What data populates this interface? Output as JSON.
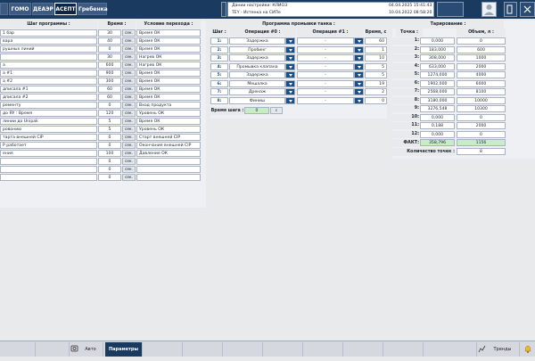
{
  "tabs": [
    "ГОМО",
    "ДЕАЭР",
    "АСЕПТ",
    "Гребенка"
  ],
  "active_tab": 2,
  "info": {
    "line1": "Дании настройки: КЛИО3",
    "line2": "TEY - Истенка на СИПе",
    "date1": "04.04.2025 15:41:43",
    "date2": "10.04.2022 08:58:20"
  },
  "program": {
    "title": "Шаг программы :",
    "time_title": "Время :",
    "cond_title": "Условие перехода :",
    "sec_label": "сек.",
    "rows": [
      {
        "name": "1 бар",
        "time": "30",
        "cond": "Время ОК"
      },
      {
        "name": "вара",
        "time": "40",
        "cond": "Время ОК"
      },
      {
        "name": "рушных линий",
        "time": "0",
        "cond": "Время ОК"
      },
      {
        "name": "",
        "time": "30",
        "cond": "Нагрев ОК"
      },
      {
        "name": "а",
        "time": "600",
        "cond": "Нагрев ОК"
      },
      {
        "name": "а #1",
        "time": "900",
        "cond": "Время ОК"
      },
      {
        "name": "а #2",
        "time": "300",
        "cond": "Время ОК"
      },
      {
        "name": "дписала #1",
        "time": "60",
        "cond": "Время ОК"
      },
      {
        "name": "дписала #2",
        "time": "60",
        "cond": "Время ОК"
      },
      {
        "name": "ременту",
        "time": "0",
        "cond": "Вход продукта"
      },
      {
        "name": "до ЯУ : Время",
        "time": "120",
        "cond": "Уровень ОК"
      },
      {
        "name": "линии до Unipak",
        "time": "5",
        "cond": "Время ОК"
      },
      {
        "name": "ровонию",
        "time": "5",
        "cond": "Уровень ОК"
      },
      {
        "name": "тарта внешней CIP",
        "time": "0",
        "cond": "Старт внешней CIP"
      },
      {
        "name": "P работает",
        "time": "0",
        "cond": "Окончание внешней CIP"
      },
      {
        "name": "ения",
        "time": "100",
        "cond": "Давление ОК"
      },
      {
        "name": "",
        "time": "0",
        "cond": ""
      },
      {
        "name": "",
        "time": "0",
        "cond": ""
      },
      {
        "name": "",
        "time": "0",
        "cond": ""
      }
    ]
  },
  "wash": {
    "title": "Программа промывки танка :",
    "col_step": "Шаг :",
    "col_op0": "Операция #0 :",
    "col_op1": "Операция #1 :",
    "col_time": "Время, с :",
    "rows": [
      {
        "step": "1:",
        "op0": "Задержка",
        "op1": "-",
        "time": "60"
      },
      {
        "step": "2:",
        "op0": "Пробинг",
        "op1": "-",
        "time": "1"
      },
      {
        "step": "3:",
        "op0": "Задержка",
        "op1": "-",
        "time": "10"
      },
      {
        "step": "4:",
        "op0": "Промывка клапана",
        "op1": "-",
        "time": "5"
      },
      {
        "step": "5:",
        "op0": "Задержка",
        "op1": "-",
        "time": "5"
      },
      {
        "step": "6:",
        "op0": "Мешалка",
        "op1": "-",
        "time": "19"
      },
      {
        "step": "7:",
        "op0": "Дренаж",
        "op1": "-",
        "time": "2"
      },
      {
        "step": "8:",
        "op0": "Финиш",
        "op1": "-",
        "time": "0"
      }
    ],
    "step_time_label": "Время шага :",
    "step_time_value": "0",
    "step_time_unit": "с"
  },
  "calib": {
    "title": "Тарирование :",
    "col_point": "Точка :",
    "col_volume": "Объем, л :",
    "rows": [
      {
        "idx": "1:",
        "point": "0,000",
        "volume": "0"
      },
      {
        "idx": "2:",
        "point": "183,000",
        "volume": "600"
      },
      {
        "idx": "3:",
        "point": "308,000",
        "volume": "1000"
      },
      {
        "idx": "4:",
        "point": "633,000",
        "volume": "2000"
      },
      {
        "idx": "5:",
        "point": "1274,000",
        "volume": "4000"
      },
      {
        "idx": "6:",
        "point": "1902,000",
        "volume": "6000"
      },
      {
        "idx": "7:",
        "point": "2568,000",
        "volume": "8100"
      },
      {
        "idx": "8:",
        "point": "3180,000",
        "volume": "10000"
      },
      {
        "idx": "9:",
        "point": "3276,548",
        "volume": "10300"
      },
      {
        "idx": "10:",
        "point": "0,000",
        "volume": "0"
      },
      {
        "idx": "11:",
        "point": "0,188",
        "volume": "2000"
      },
      {
        "idx": "12:",
        "point": "0,000",
        "volume": "0"
      }
    ],
    "fact_label": "ФАКТ:",
    "fact_point": "358,796",
    "fact_volume": "1156",
    "count_label": "Количество точек :",
    "count_value": "8"
  },
  "bottom": {
    "auto": "Авто",
    "params": "Параметры",
    "trends": "Тренды"
  }
}
